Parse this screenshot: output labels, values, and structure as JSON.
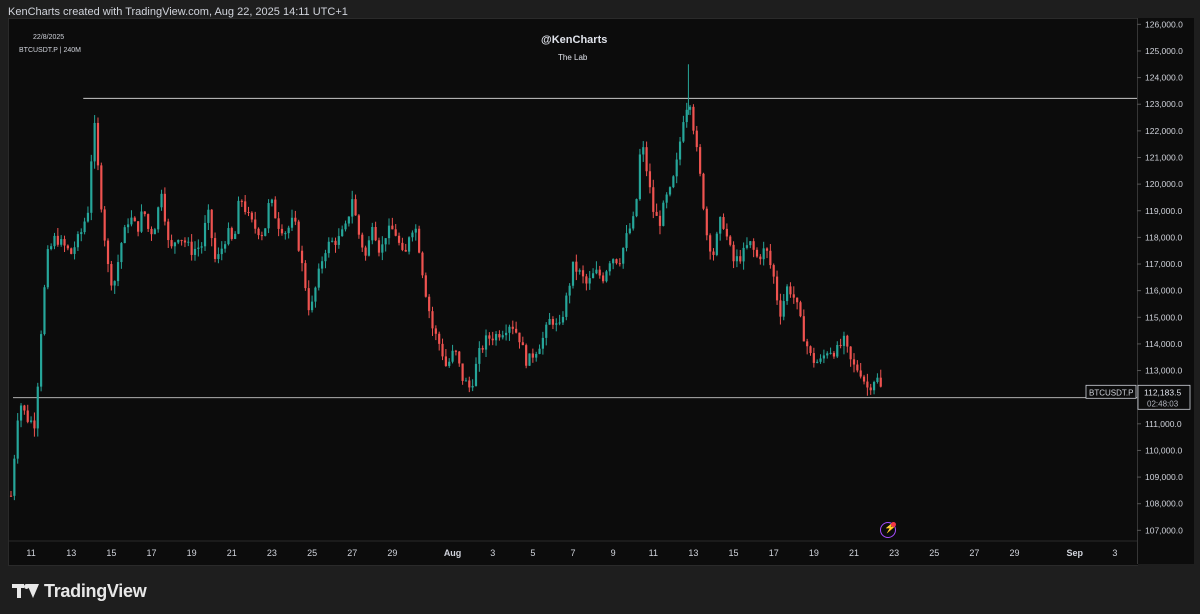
{
  "header": {
    "attribution": "KenCharts created with TradingView.com, Aug 22, 2025 14:11 UTC+1",
    "date_label": "22/8/2025",
    "symbol_interval": "BTCUSDT.P | 240M",
    "author": "@KenCharts",
    "subtitle": "The Lab"
  },
  "branding": {
    "name": "TradingView",
    "logo_icon": "tradingview-logo-icon"
  },
  "price_tag": {
    "symbol": "BTCUSDT.P",
    "price": "112,183.5",
    "countdown": "02:48:03"
  },
  "colors": {
    "up": "#26a69a",
    "down": "#ef5350",
    "background": "#0c0c0c",
    "text": "#d1d4dc",
    "level_line": "#c8c8c8",
    "alert_icon": "#a64dff"
  },
  "icons": {
    "alert": "lightning-alert-icon"
  },
  "chart_data": {
    "type": "candlestick",
    "title": "BTCUSDT.P",
    "interval": "240M",
    "ylim": [
      106600,
      126200
    ],
    "y_ticks": [
      "107,000.0",
      "108,000.0",
      "109,000.0",
      "110,000.0",
      "111,000.0",
      "112,000.0",
      "113,000.0",
      "114,000.0",
      "115,000.0",
      "116,000.0",
      "117,000.0",
      "118,000.0",
      "119,000.0",
      "120,000.0",
      "121,000.0",
      "122,000.0",
      "123,000.0",
      "124,000.0",
      "125,000.0",
      "126,000.0"
    ],
    "x_ticks": [
      {
        "label": "11",
        "day": 11
      },
      {
        "label": "13",
        "day": 13
      },
      {
        "label": "15",
        "day": 15
      },
      {
        "label": "17",
        "day": 17
      },
      {
        "label": "19",
        "day": 19
      },
      {
        "label": "21",
        "day": 21
      },
      {
        "label": "23",
        "day": 23
      },
      {
        "label": "25",
        "day": 25
      },
      {
        "label": "27",
        "day": 27
      },
      {
        "label": "29",
        "day": 29
      },
      {
        "label": "Aug",
        "day": 32
      },
      {
        "label": "3",
        "day": 34
      },
      {
        "label": "5",
        "day": 36
      },
      {
        "label": "7",
        "day": 38
      },
      {
        "label": "9",
        "day": 40
      },
      {
        "label": "11",
        "day": 42
      },
      {
        "label": "13",
        "day": 44
      },
      {
        "label": "15",
        "day": 46
      },
      {
        "label": "17",
        "day": 48
      },
      {
        "label": "19",
        "day": 50
      },
      {
        "label": "21",
        "day": 52
      },
      {
        "label": "23",
        "day": 54
      },
      {
        "label": "25",
        "day": 56
      },
      {
        "label": "27",
        "day": 58
      },
      {
        "label": "29",
        "day": 60
      },
      {
        "label": "Sep",
        "day": 63
      },
      {
        "label": "3",
        "day": 65
      }
    ],
    "x_range_days": [
      9.9,
      66.1
    ],
    "last_price": 112183.5,
    "levels": [
      {
        "price": 123220,
        "from_day": 13.6
      },
      {
        "price": 111980,
        "from_day": 10.1
      }
    ],
    "anchors": [
      [
        10.0,
        108300
      ],
      [
        10.4,
        111900
      ],
      [
        10.8,
        111200
      ],
      [
        11.2,
        111000
      ],
      [
        11.5,
        114500
      ],
      [
        11.8,
        117300
      ],
      [
        12.2,
        118000
      ],
      [
        12.6,
        117700
      ],
      [
        13.0,
        117400
      ],
      [
        13.5,
        118200
      ],
      [
        13.9,
        119200
      ],
      [
        14.1,
        122700
      ],
      [
        14.4,
        120000
      ],
      [
        14.8,
        117000
      ],
      [
        15.1,
        116100
      ],
      [
        15.5,
        117800
      ],
      [
        15.9,
        118800
      ],
      [
        16.3,
        118300
      ],
      [
        16.6,
        119100
      ],
      [
        16.9,
        118100
      ],
      [
        17.2,
        118500
      ],
      [
        17.5,
        119800
      ],
      [
        17.9,
        117400
      ],
      [
        18.3,
        118100
      ],
      [
        18.6,
        117900
      ],
      [
        19.0,
        117500
      ],
      [
        19.5,
        117700
      ],
      [
        19.8,
        119000
      ],
      [
        20.2,
        117000
      ],
      [
        20.5,
        117600
      ],
      [
        20.8,
        118200
      ],
      [
        21.1,
        117700
      ],
      [
        21.4,
        119600
      ],
      [
        21.8,
        118800
      ],
      [
        22.1,
        118400
      ],
      [
        22.6,
        118100
      ],
      [
        22.9,
        119500
      ],
      [
        23.3,
        118500
      ],
      [
        23.7,
        118200
      ],
      [
        24.1,
        118700
      ],
      [
        24.6,
        116500
      ],
      [
        24.9,
        115100
      ],
      [
        25.2,
        116200
      ],
      [
        25.6,
        117500
      ],
      [
        25.9,
        117800
      ],
      [
        26.3,
        117900
      ],
      [
        26.7,
        118400
      ],
      [
        27.0,
        119500
      ],
      [
        27.3,
        118200
      ],
      [
        27.7,
        117200
      ],
      [
        28.0,
        118600
      ],
      [
        28.4,
        117400
      ],
      [
        28.7,
        118200
      ],
      [
        29.1,
        118300
      ],
      [
        29.6,
        117100
      ],
      [
        29.9,
        118400
      ],
      [
        30.2,
        118300
      ],
      [
        30.6,
        116200
      ],
      [
        31.0,
        114600
      ],
      [
        31.4,
        113900
      ],
      [
        31.7,
        113100
      ],
      [
        32.1,
        113800
      ],
      [
        32.5,
        112700
      ],
      [
        32.9,
        112300
      ],
      [
        33.3,
        113600
      ],
      [
        33.7,
        114200
      ],
      [
        34.1,
        114300
      ],
      [
        34.5,
        114500
      ],
      [
        34.9,
        114800
      ],
      [
        35.3,
        114300
      ],
      [
        35.7,
        113300
      ],
      [
        36.1,
        113700
      ],
      [
        36.5,
        114200
      ],
      [
        36.9,
        115000
      ],
      [
        37.3,
        114500
      ],
      [
        37.7,
        115800
      ],
      [
        38.0,
        116900
      ],
      [
        38.3,
        116700
      ],
      [
        38.7,
        116200
      ],
      [
        39.1,
        116700
      ],
      [
        39.5,
        116500
      ],
      [
        39.9,
        117300
      ],
      [
        40.3,
        117100
      ],
      [
        40.7,
        118100
      ],
      [
        41.1,
        118800
      ],
      [
        41.4,
        121700
      ],
      [
        41.7,
        120400
      ],
      [
        42.0,
        119000
      ],
      [
        42.3,
        118500
      ],
      [
        42.6,
        119400
      ],
      [
        42.9,
        119800
      ],
      [
        43.2,
        120900
      ],
      [
        43.5,
        122500
      ],
      [
        43.8,
        123300
      ],
      [
        44.1,
        121600
      ],
      [
        44.4,
        119900
      ],
      [
        44.7,
        117900
      ],
      [
        45.0,
        117400
      ],
      [
        45.4,
        118800
      ],
      [
        45.7,
        117900
      ],
      [
        46.0,
        117100
      ],
      [
        46.4,
        117300
      ],
      [
        46.8,
        117800
      ],
      [
        47.2,
        117200
      ],
      [
        47.6,
        117600
      ],
      [
        48.0,
        116500
      ],
      [
        48.3,
        115100
      ],
      [
        48.7,
        116200
      ],
      [
        49.1,
        115600
      ],
      [
        49.5,
        114300
      ],
      [
        49.9,
        113400
      ],
      [
        50.3,
        113300
      ],
      [
        50.7,
        113800
      ],
      [
        51.1,
        113700
      ],
      [
        51.5,
        114100
      ],
      [
        51.9,
        113200
      ],
      [
        52.3,
        113000
      ],
      [
        52.7,
        112300
      ],
      [
        53.1,
        112800
      ],
      [
        53.4,
        112200
      ]
    ]
  }
}
